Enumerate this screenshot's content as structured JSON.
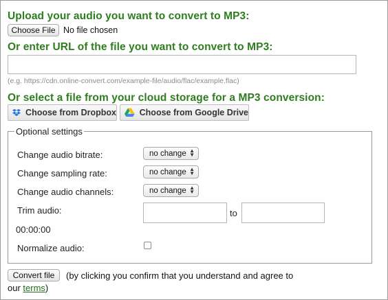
{
  "upload": {
    "heading": "Upload your audio you want to convert to MP3:",
    "choose_file_label": "Choose File",
    "no_file_text": "No file chosen"
  },
  "url": {
    "heading": "Or enter URL of the file you want to convert to MP3:",
    "value": "",
    "hint": "(e.g. https://cdn.online-convert.com/example-file/audio/flac/example.flac)"
  },
  "cloud": {
    "heading": "Or select a file from your cloud storage for a MP3 conversion:",
    "dropbox_label": "Choose from Dropbox",
    "gdrive_label": "Choose from Google Drive"
  },
  "options": {
    "legend": "Optional settings",
    "bitrate_label": "Change audio bitrate:",
    "bitrate_value": "no change",
    "sampling_label": "Change sampling rate:",
    "sampling_value": "no change",
    "channels_label": "Change audio channels:",
    "channels_value": "no change",
    "trim_label": "Trim audio:",
    "trim_time": "00:00:00",
    "trim_to": "to",
    "normalize_label": "Normalize audio:",
    "normalize_checked": false
  },
  "footer": {
    "convert_label": "Convert file",
    "text_before": "(by clicking you confirm that you understand and agree to",
    "text_our": "our ",
    "terms_link": "terms",
    "text_after": ")"
  },
  "colors": {
    "heading_green": "#2e7d1f",
    "dropbox_blue": "#1f7ae0",
    "link_green": "#1a6e1a"
  },
  "icons": [
    "dropbox-icon",
    "google-drive-icon"
  ]
}
